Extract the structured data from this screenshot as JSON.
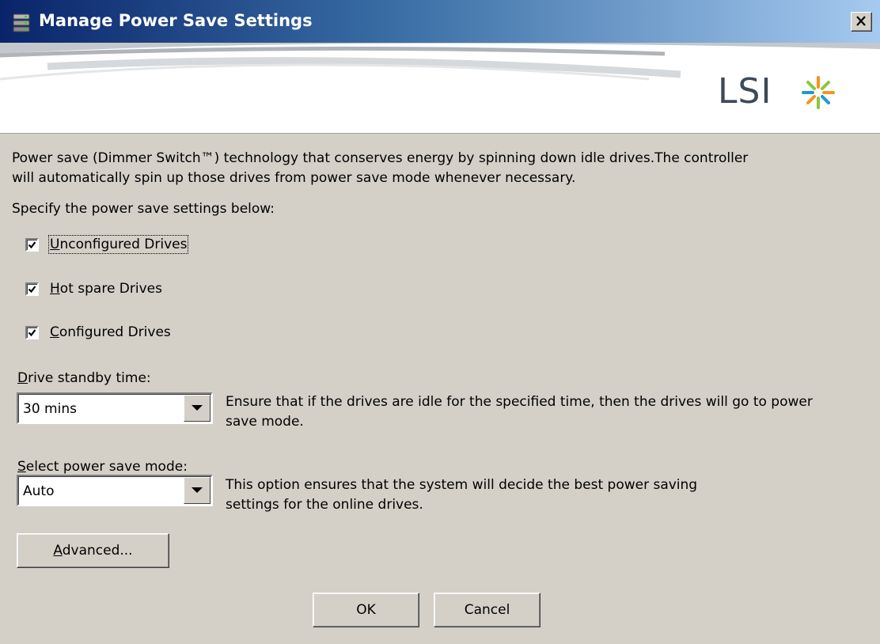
{
  "window": {
    "title": "Manage Power Save Settings",
    "logo_text": "LSI"
  },
  "description": {
    "line1": "Power save (Dimmer Switch™) technology that conserves energy by spinning down idle drives.The controller",
    "line2": "will automatically spin up those drives from power save mode whenever necessary."
  },
  "specify_label": "Specify the power save settings below:",
  "checkboxes": {
    "unconfigured": {
      "mnemonic": "U",
      "rest": "nconfigured Drives",
      "checked": true
    },
    "hotspare": {
      "mnemonic": "H",
      "rest": "ot spare Drives",
      "checked": true
    },
    "configured": {
      "mnemonic": "C",
      "rest": "onfigured Drives",
      "checked": true
    }
  },
  "standby": {
    "label_mnemonic": "D",
    "label_rest": "rive standby time:",
    "value": "30 mins",
    "help_line1": "Ensure that if the drives are idle for the specified time, then the drives will go to power",
    "help_line2": "save mode."
  },
  "mode": {
    "label_mnemonic": "S",
    "label_rest": "elect power save mode:",
    "value": "Auto",
    "help_line1": "This option ensures that the system will decide the best power saving",
    "help_line2": "settings for the online drives."
  },
  "buttons": {
    "advanced_mnemonic": "A",
    "advanced_rest": "dvanced...",
    "ok": "OK",
    "cancel": "Cancel"
  },
  "icons": {
    "title": "drive-stack-icon",
    "close": "close-icon",
    "check": "checkmark-icon",
    "dropdown": "chevron-down-icon",
    "logo_mark": "lsi-starburst-logo"
  },
  "colors": {
    "title_gradient_start": "#0a246a",
    "title_gradient_end": "#a6caf0",
    "dialog_bg": "#d4d0c8"
  }
}
